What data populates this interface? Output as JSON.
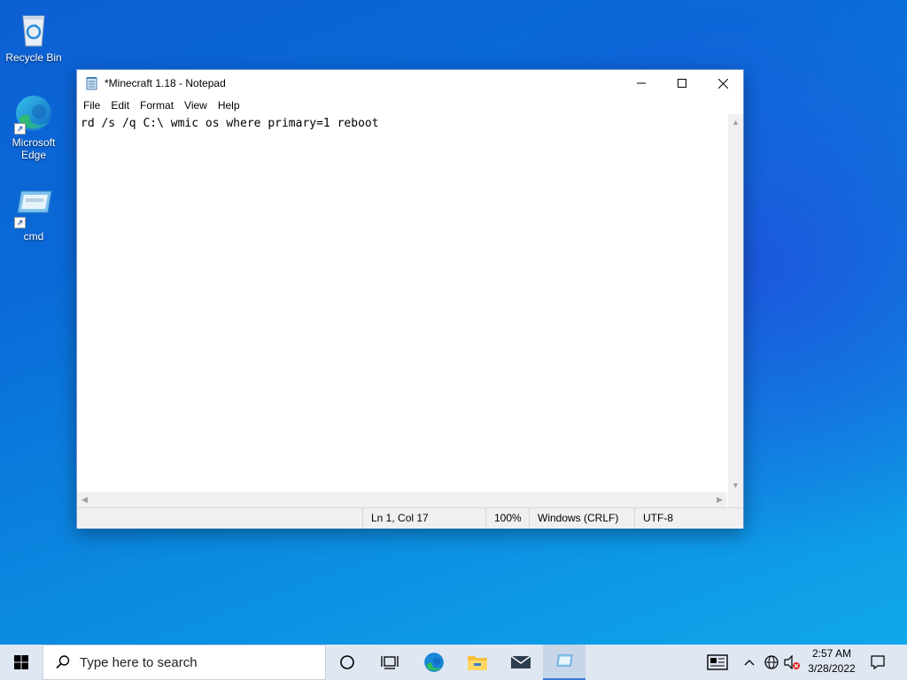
{
  "desktop": {
    "icons": [
      {
        "label": "Recycle Bin"
      },
      {
        "label": "Microsoft Edge"
      },
      {
        "label": "cmd"
      }
    ]
  },
  "notepad": {
    "title": "*Minecraft 1.18 - Notepad",
    "menu": [
      "File",
      "Edit",
      "Format",
      "View",
      "Help"
    ],
    "content": "rd /s /q C:\\ wmic os where primary=1 reboot",
    "status": {
      "position": "Ln 1, Col 17",
      "zoom": "100%",
      "line_ending": "Windows (CRLF)",
      "encoding": "UTF-8"
    }
  },
  "taskbar": {
    "search_placeholder": "Type here to search",
    "time": "2:57 AM",
    "date": "3/28/2022",
    "pinned": [
      "cortana-icon",
      "task-view-icon",
      "edge-icon",
      "file-explorer-icon",
      "mail-icon",
      "notepad-icon"
    ]
  },
  "colors": {
    "accent": "#3b78d8",
    "taskbar": "#dfe7f3"
  }
}
